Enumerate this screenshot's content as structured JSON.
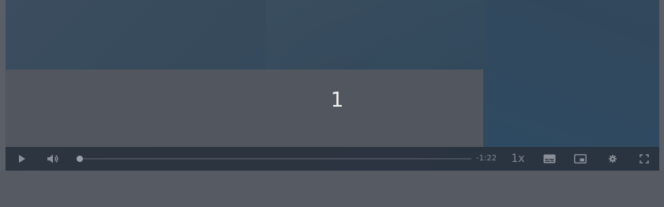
{
  "player": {
    "caption": "1",
    "time_remaining": "-1:22",
    "playback_rate": "1x",
    "progress_fraction": 0.0,
    "controls": {
      "play_icon": "play-icon",
      "volume_icon": "volume-icon",
      "captions_icon": "captions-icon",
      "pip_icon": "picture-in-picture-icon",
      "settings_icon": "gear-icon",
      "fullscreen_icon": "fullscreen-icon"
    }
  },
  "colors": {
    "video_bg": "#34495b",
    "overlay": "#555860",
    "control_bar": "#2c3038",
    "control_icon": "#8a9099",
    "caption_text": "#f2f2f2"
  }
}
